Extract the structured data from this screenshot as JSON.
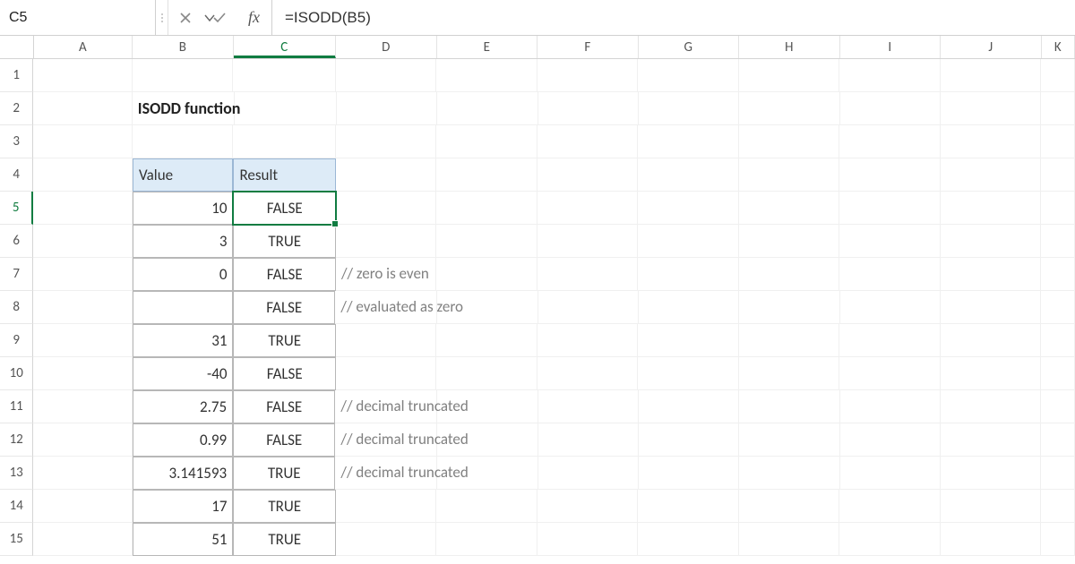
{
  "formula_bar": {
    "cell_ref": "C5",
    "formula": "=ISODD(B5)"
  },
  "columns": [
    "A",
    "B",
    "C",
    "D",
    "E",
    "F",
    "G",
    "H",
    "I",
    "J",
    "K"
  ],
  "row_numbers": [
    "1",
    "2",
    "3",
    "4",
    "5",
    "6",
    "7",
    "8",
    "9",
    "10",
    "11",
    "12",
    "13",
    "14",
    "15"
  ],
  "sheet": {
    "title": "ISODD function",
    "header_value": "Value",
    "header_result": "Result",
    "rows": [
      {
        "value": "10",
        "result": "FALSE",
        "comment": ""
      },
      {
        "value": "3",
        "result": "TRUE",
        "comment": ""
      },
      {
        "value": "0",
        "result": "FALSE",
        "comment": "// zero is even"
      },
      {
        "value": "",
        "result": "FALSE",
        "comment": "// evaluated as zero"
      },
      {
        "value": "31",
        "result": "TRUE",
        "comment": ""
      },
      {
        "value": "-40",
        "result": "FALSE",
        "comment": ""
      },
      {
        "value": "2.75",
        "result": "FALSE",
        "comment": "// decimal truncated"
      },
      {
        "value": "0.99",
        "result": "FALSE",
        "comment": "// decimal truncated"
      },
      {
        "value": "3.141593",
        "result": "TRUE",
        "comment": "// decimal truncated"
      },
      {
        "value": "17",
        "result": "TRUE",
        "comment": ""
      },
      {
        "value": "51",
        "result": "TRUE",
        "comment": ""
      }
    ]
  },
  "active": {
    "col": "C",
    "row": "5"
  }
}
